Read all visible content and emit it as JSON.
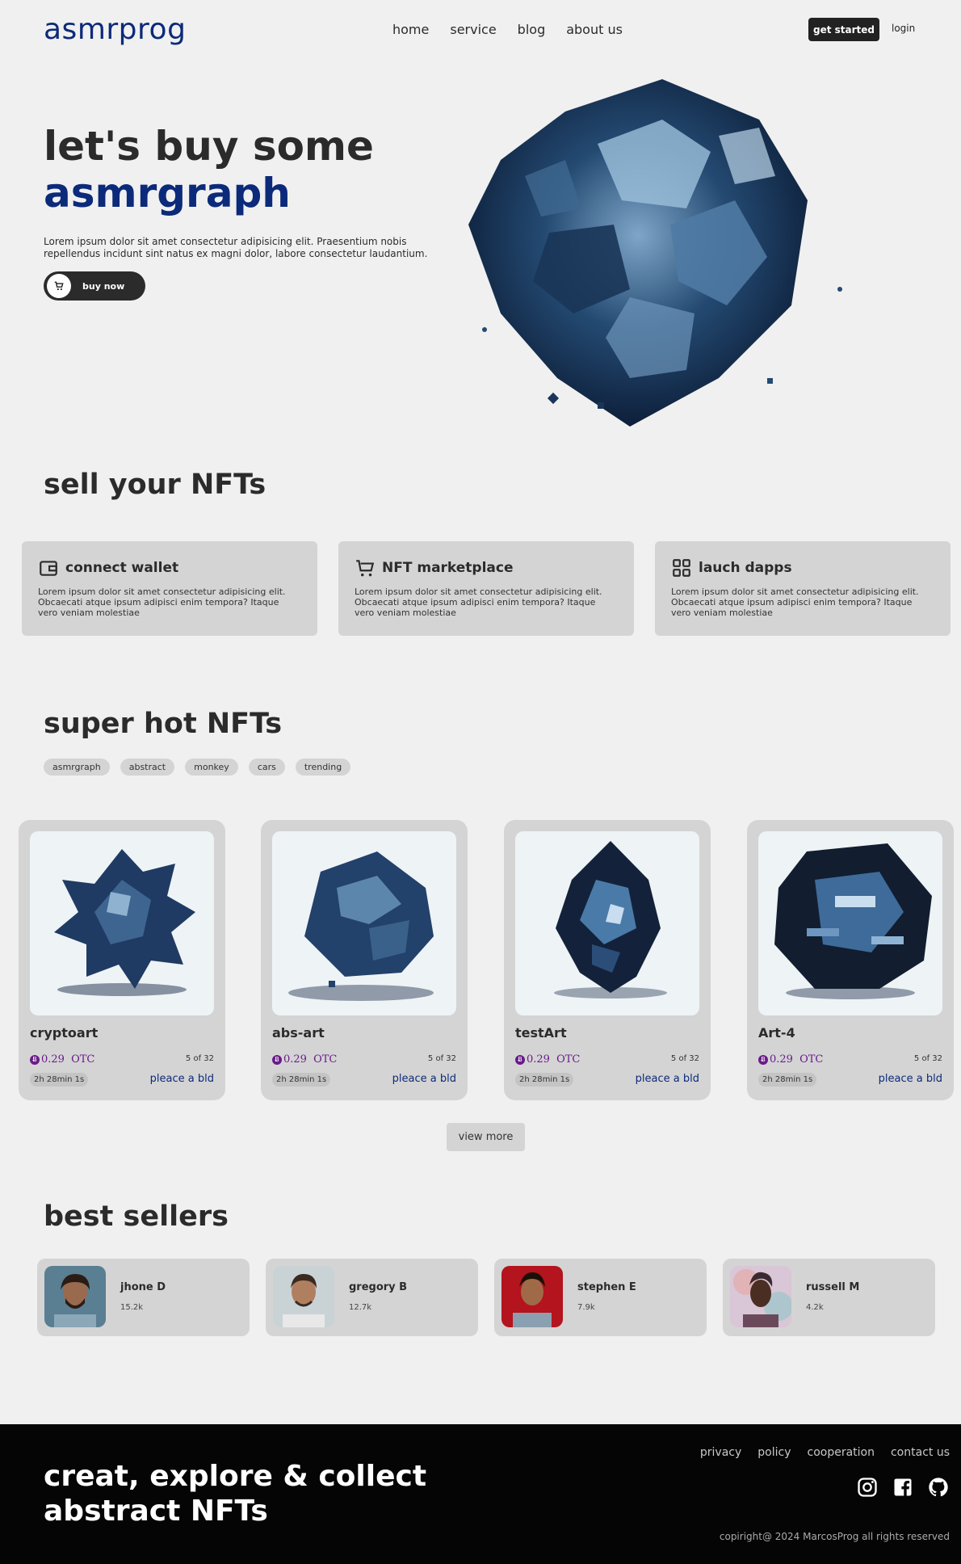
{
  "nav": {
    "logo": "asmrprog",
    "links": [
      "home",
      "service",
      "blog",
      "about us"
    ],
    "get_started": "get started",
    "login": "login"
  },
  "hero": {
    "title_line1": "let's buy some",
    "title_line2": "asmrgraph",
    "description": "Lorem ipsum dolor sit amet consectetur adipisicing elit. Praesentium nobis repellendus incidunt sint natus ex magni dolor, labore consectetur laudantium.",
    "buy_label": "buy now"
  },
  "sell": {
    "title": "sell your NFTs",
    "cards": [
      {
        "icon": "wallet-icon",
        "title": "connect wallet",
        "text": "Lorem ipsum dolor sit amet consectetur adipisicing elit. Obcaecati atque ipsum adipisci enim tempora? Itaque vero veniam molestiae"
      },
      {
        "icon": "cart-icon",
        "title": "NFT marketplace",
        "text": "Lorem ipsum dolor sit amet consectetur adipisicing elit. Obcaecati atque ipsum adipisci enim tempora? Itaque vero veniam molestiae"
      },
      {
        "icon": "grid-icon",
        "title": "lauch dapps",
        "text": "Lorem ipsum dolor sit amet consectetur adipisicing elit. Obcaecati atque ipsum adipisci enim tempora? Itaque vero veniam molestiae"
      }
    ]
  },
  "hot": {
    "title": "super hot NFTs",
    "tags": [
      "asmrgraph",
      "abstract",
      "monkey",
      "cars",
      "trending"
    ],
    "items": [
      {
        "name": "cryptoart",
        "price": "0.29",
        "currency": "OTC",
        "count": "5 of 32",
        "timer": "2h 28min 1s",
        "bid": "pleace a bld"
      },
      {
        "name": "abs-art",
        "price": "0.29",
        "currency": "OTC",
        "count": "5 of 32",
        "timer": "2h 28min 1s",
        "bid": "pleace a bld"
      },
      {
        "name": "testArt",
        "price": "0.29",
        "currency": "OTC",
        "count": "5 of 32",
        "timer": "2h 28min 1s",
        "bid": "pleace a bld"
      },
      {
        "name": "Art-4",
        "price": "0.29",
        "currency": "OTC",
        "count": "5 of 32",
        "timer": "2h 28min 1s",
        "bid": "pleace a bld"
      }
    ],
    "view_more": "view more"
  },
  "sellers": {
    "title": "best sellers",
    "items": [
      {
        "name": "jhone D",
        "followers": "15.2k"
      },
      {
        "name": "gregory B",
        "followers": "12.7k"
      },
      {
        "name": "stephen E",
        "followers": "7.9k"
      },
      {
        "name": "russell M",
        "followers": "4.2k"
      }
    ]
  },
  "footer": {
    "title_line1": "creat, explore & collect",
    "title_line2": "abstract NFTs",
    "links": [
      "privacy",
      "policy",
      "cooperation",
      "contact us"
    ],
    "social": [
      "instagram-icon",
      "facebook-icon",
      "github-icon"
    ],
    "copyright": "copiright@ 2024 MarcosProg all rights reserved"
  },
  "colors": {
    "accent": "#0c2a7a",
    "dark": "#2b2b2b",
    "card": "#d4d4d4",
    "price": "#6a1b8a"
  }
}
